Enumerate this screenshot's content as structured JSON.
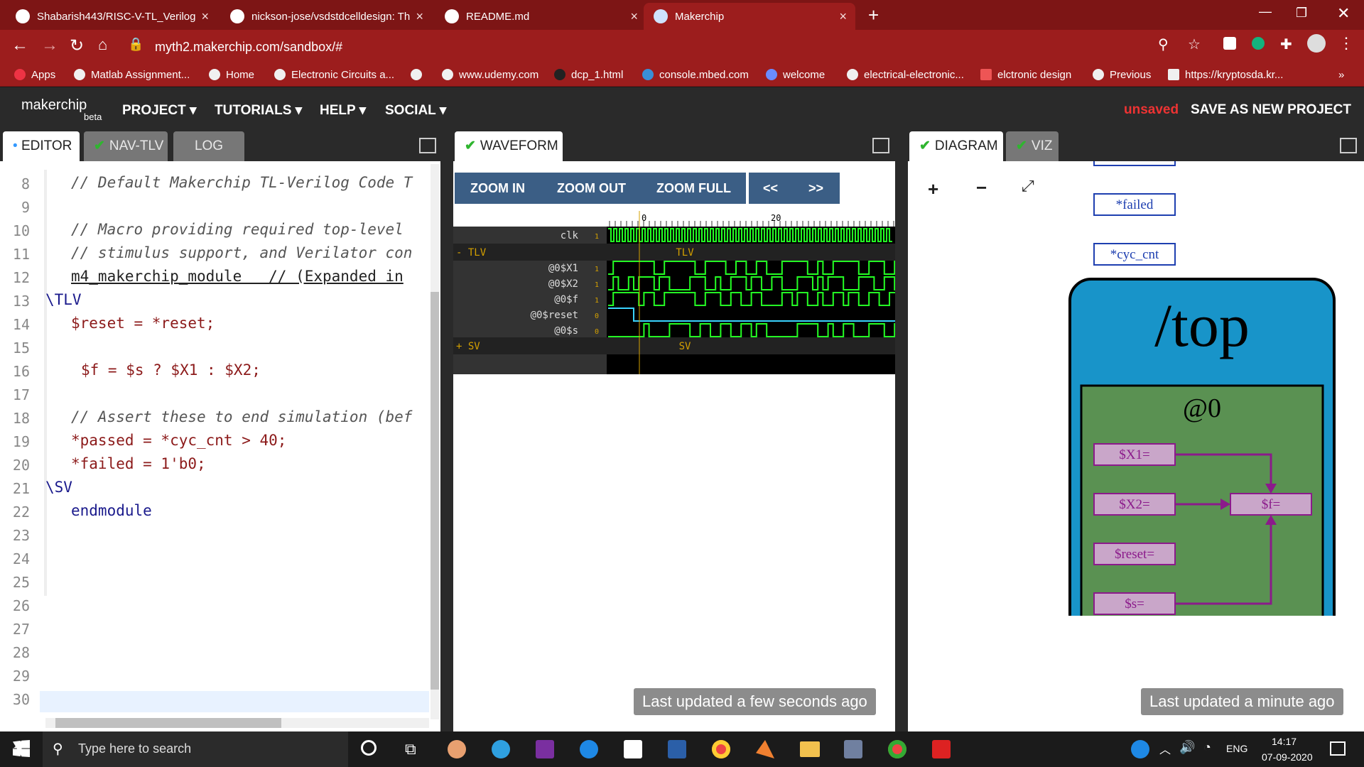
{
  "browser": {
    "tabs": [
      {
        "label": "Shabarish443/RISC-V-TL_Verilog"
      },
      {
        "label": "nickson-jose/vsdstdcelldesign: Th"
      },
      {
        "label": "README.md"
      },
      {
        "label": "Makerchip"
      }
    ],
    "url": "myth2.makerchip.com/sandbox/#",
    "bookmarks": [
      "Apps",
      "Matlab Assignment...",
      "Home",
      "Electronic Circuits a...",
      "",
      "www.udemy.com",
      "dcp_1.html",
      "console.mbed.com",
      "welcome",
      "electrical-electronic...",
      "elctronic design",
      "Previous",
      "https://kryptosda.kr..."
    ]
  },
  "header": {
    "logo": "makerchip",
    "beta": "beta",
    "nav": [
      "PROJECT",
      "TUTORIALS",
      "HELP",
      "SOCIAL"
    ],
    "status": "unsaved",
    "save": "SAVE AS NEW PROJECT"
  },
  "editor": {
    "tabs": [
      "EDITOR",
      "NAV-TLV",
      "LOG"
    ],
    "lines": [
      {
        "n": "8",
        "t": "// Default Makerchip TL-Verilog Code T"
      },
      {
        "n": "9",
        "t": ""
      },
      {
        "n": "10",
        "t": "// Macro providing required top-level"
      },
      {
        "n": "11",
        "t": "// stimulus support, and Verilator con"
      },
      {
        "n": "12",
        "t": "m4_makerchip_module   // (Expanded in"
      },
      {
        "n": "13",
        "t": "\\TLV"
      },
      {
        "n": "14",
        "t": "$reset = *reset;"
      },
      {
        "n": "15",
        "t": ""
      },
      {
        "n": "16",
        "t": "$f = $s ? $X1 : $X2;"
      },
      {
        "n": "17",
        "t": ""
      },
      {
        "n": "18",
        "t": "// Assert these to end simulation (bef"
      },
      {
        "n": "19",
        "t": "*passed = *cyc_cnt > 40;"
      },
      {
        "n": "20",
        "t": "*failed = 1'b0;"
      },
      {
        "n": "21",
        "t": "\\SV"
      },
      {
        "n": "22",
        "t": "endmodule"
      },
      {
        "n": "23",
        "t": ""
      },
      {
        "n": "24",
        "t": ""
      },
      {
        "n": "25",
        "t": ""
      },
      {
        "n": "26",
        "t": ""
      },
      {
        "n": "27",
        "t": ""
      },
      {
        "n": "28",
        "t": ""
      },
      {
        "n": "29",
        "t": ""
      },
      {
        "n": "30",
        "t": ""
      }
    ]
  },
  "waveform": {
    "tab": "WAVEFORM",
    "buttons": [
      "ZOOM IN",
      "ZOOM OUT",
      "ZOOM FULL",
      "<<",
      ">>"
    ],
    "ticks": [
      "0",
      "20"
    ],
    "signals": [
      {
        "name": "clk",
        "val": "1"
      },
      {
        "name": "- TLV",
        "val": "TLV"
      },
      {
        "name": "@0$X1",
        "val": "1"
      },
      {
        "name": "@0$X2",
        "val": "1"
      },
      {
        "name": "@0$f",
        "val": "1"
      },
      {
        "name": "@0$reset",
        "val": "0"
      },
      {
        "name": "@0$s",
        "val": "0"
      },
      {
        "name": "+ SV",
        "val": "SV"
      }
    ],
    "updated": "Last updated a few seconds ago"
  },
  "diagram": {
    "tabs": [
      "DIAGRAM",
      "VIZ"
    ],
    "nodes_top": [
      "*failed",
      "*cyc_cnt"
    ],
    "scope": "/top",
    "stage": "@0",
    "nodes": [
      "$X1=",
      "$X2=",
      "$reset=",
      "$s=",
      "$f="
    ],
    "updated": "Last updated a minute ago"
  },
  "taskbar": {
    "search": "Type here to search",
    "lang": "ENG",
    "time": "14:17",
    "date": "07-09-2020"
  },
  "colors": {
    "chrome": "#9c1d1d",
    "wave_green": "#24ff24",
    "wave_blue": "#3ad3ff",
    "diagram_blue": "#1894c9",
    "diagram_green": "#5a9152",
    "node": "#8b1a8b"
  }
}
